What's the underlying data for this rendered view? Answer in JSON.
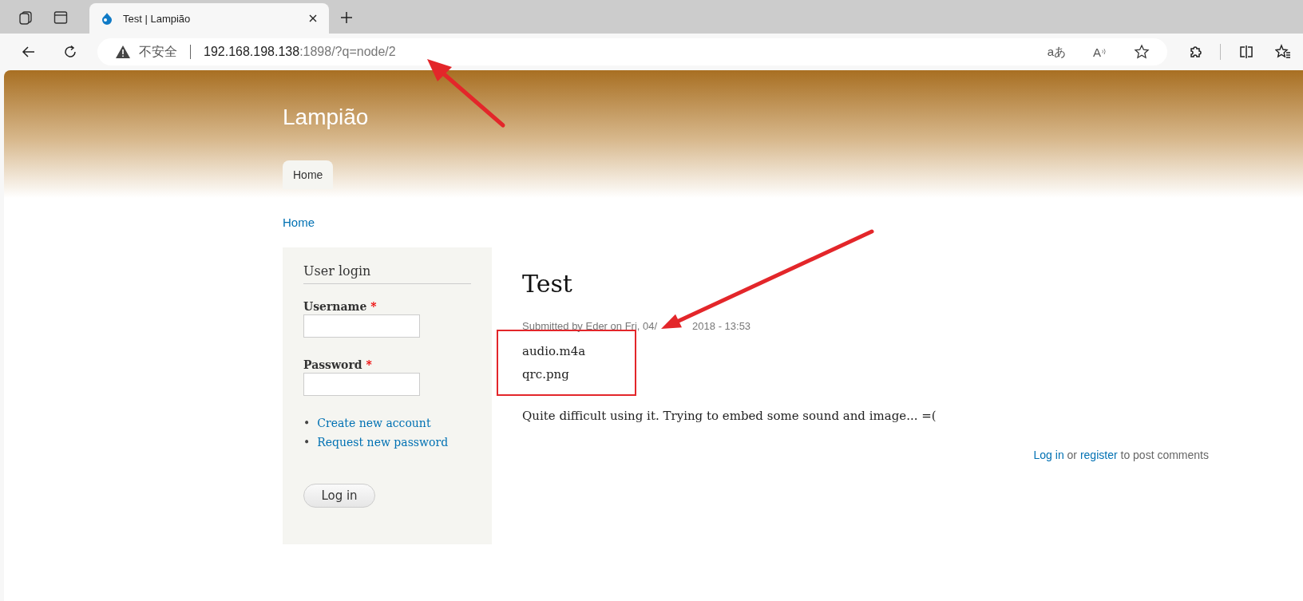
{
  "browser": {
    "tabs": [
      {
        "title": "Test | Lampião",
        "selected": true
      }
    ],
    "address": {
      "security": "不安全",
      "host": "192.168.198.138",
      "rest": ":1898/?q=node/2"
    },
    "glyphs": {
      "translate": "aあ",
      "read_aloud": "A"
    }
  },
  "site": {
    "name": "Lampião",
    "nav": [
      {
        "label": "Home",
        "selected": true
      }
    ],
    "breadcrumb": [
      "Home"
    ]
  },
  "login": {
    "title": "User login",
    "required_mark": "*",
    "fields": [
      {
        "label": "Username",
        "required": true
      },
      {
        "label": "Password",
        "required": true
      }
    ],
    "bullet": "•",
    "links": [
      "Create new account",
      "Request new password"
    ],
    "button": "Log in"
  },
  "node": {
    "title": "Test",
    "submitted": [
      "Submitted by Eder on Fri, 04/",
      "2018 - 13:53"
    ],
    "attachments": [
      "audio.m4a",
      "qrc.png"
    ],
    "body": "Quite difficult using it. Trying to embed some sound and image... =(",
    "comments": {
      "login": "Log in",
      "or": "or",
      "register": "register",
      "rest": "to post comments"
    }
  }
}
